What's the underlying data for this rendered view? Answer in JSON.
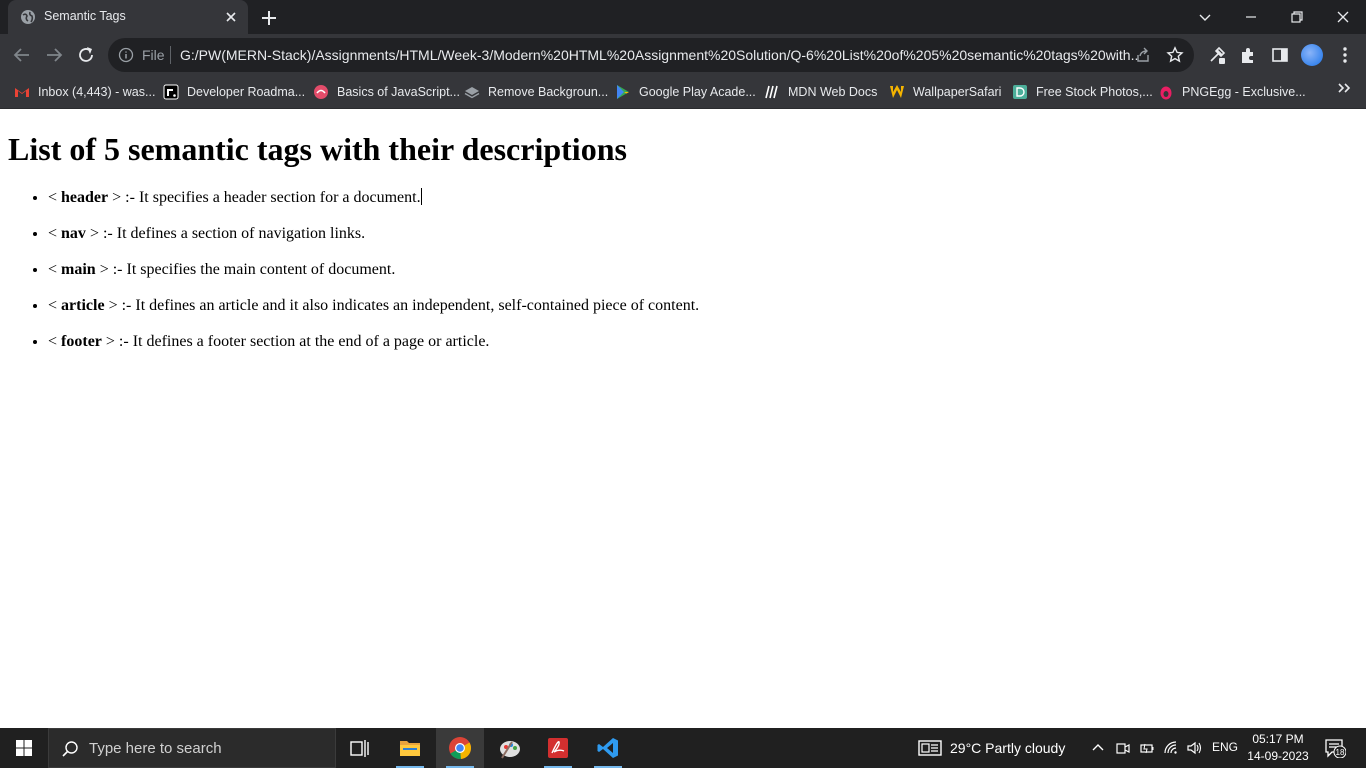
{
  "browser": {
    "tab": {
      "title": "Semantic Tags",
      "favicon": "globe-icon"
    },
    "address": {
      "scheme_label": "File",
      "url": "G:/PW(MERN-Stack)/Assignments/HTML/Week-3/Modern%20HTML%20Assignment%20Solution/Q-6%20List%20of%205%20semantic%20tags%20with..."
    },
    "bookmarks": [
      {
        "label": "Inbox (4,443) - was...",
        "icon": "gmail-icon",
        "color": "#ea4335"
      },
      {
        "label": "Developer Roadma...",
        "icon": "roadmap-icon",
        "color": "#ffffff"
      },
      {
        "label": "Basics of JavaScript...",
        "icon": "javascript-icon",
        "color": "#e34c6a"
      },
      {
        "label": "Remove Backgroun...",
        "icon": "layers-icon",
        "color": "#9aa0a6"
      },
      {
        "label": "Google Play Acade...",
        "icon": "google-play-icon",
        "color": "#34a853"
      },
      {
        "label": "MDN Web Docs",
        "icon": "mdn-icon",
        "color": "#ffffff"
      },
      {
        "label": "WallpaperSafari",
        "icon": "wallpapersafari-icon",
        "color": "#f4b400"
      },
      {
        "label": "Free Stock Photos,...",
        "icon": "stock-photos-icon",
        "color": "#4caf9a"
      },
      {
        "label": "PNGEgg - Exclusive...",
        "icon": "pngegg-icon",
        "color": "#e91e63"
      }
    ]
  },
  "page": {
    "heading": "List of 5 semantic tags with their descriptions",
    "items": [
      {
        "open": "< ",
        "tag": "header",
        "close": " >",
        "desc": " :- It specifies a header section for a document."
      },
      {
        "open": "< ",
        "tag": "nav",
        "close": " >",
        "desc": " :- It defines a section of navigation links."
      },
      {
        "open": "< ",
        "tag": "main",
        "close": " >",
        "desc": " :- It specifies the main content of document."
      },
      {
        "open": "< ",
        "tag": "article",
        "close": " >",
        "desc": " :- It defines an article and it also indicates an independent, self-contained piece of content."
      },
      {
        "open": "< ",
        "tag": "footer",
        "close": " >",
        "desc": " :- It defines a footer section at the end of a page or article."
      }
    ]
  },
  "taskbar": {
    "search_placeholder": "Type here to search",
    "weather": "29°C  Partly cloudy",
    "language": "ENG",
    "time": "05:17 PM",
    "date": "14-09-2023",
    "notification_count": "18"
  },
  "colors": {
    "tab_strip": "#202124",
    "toolbar": "#35363a",
    "taskbar": "#202020",
    "accent": "#76b9ed"
  }
}
